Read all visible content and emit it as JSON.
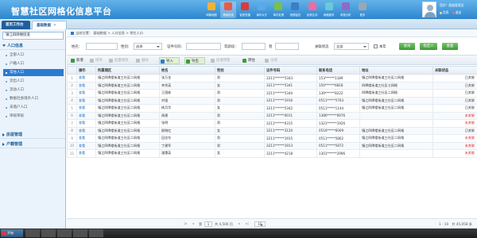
{
  "header": {
    "app_title": "智慧社区网格化信息平台",
    "user_greeting": "您好！超级管理员",
    "links": [
      "信息",
      "退出"
    ],
    "modules": [
      {
        "label": "网格地图",
        "color": "#f3b233",
        "icon": "map-icon"
      },
      {
        "label": "基础信息",
        "color": "#e95a4a",
        "icon": "database-icon",
        "active": true
      },
      {
        "label": "智慧党建",
        "color": "#d83c3c",
        "icon": "party-icon"
      },
      {
        "label": "事件大厅",
        "color": "#5aa9e8",
        "icon": "event-icon"
      },
      {
        "label": "事件处理",
        "color": "#7bc043",
        "icon": "process-icon"
      },
      {
        "label": "视频监控",
        "color": "#3c7fc4",
        "icon": "camera-icon"
      },
      {
        "label": "民情互动",
        "color": "#f06aa0",
        "icon": "chat-icon"
      },
      {
        "label": "网格服务",
        "color": "#6bc8d6",
        "icon": "service-icon"
      },
      {
        "label": "考核分析",
        "color": "#8d6cc8",
        "icon": "chart-icon"
      },
      {
        "label": "更多",
        "color": "#9aa7b3",
        "icon": "more-icon"
      }
    ]
  },
  "tabs": [
    {
      "label": "首页工作台"
    },
    {
      "label": "基础数据",
      "close": "✕"
    }
  ],
  "sidebar": {
    "select_value": "镇江四牌楼街道",
    "sections": [
      {
        "label": "人口信息",
        "expanded": true
      },
      {
        "label": "房屋管理",
        "expanded": false
      },
      {
        "label": "户籍管理",
        "expanded": false
      }
    ],
    "items": [
      {
        "label": "全部人口"
      },
      {
        "label": "户籍人口"
      },
      {
        "label": "常住人口",
        "active": true
      },
      {
        "label": "流出人口"
      },
      {
        "label": "流动人口"
      },
      {
        "label": "数据社会境外人口"
      },
      {
        "label": "未落户人口"
      },
      {
        "label": "审核审核"
      }
    ]
  },
  "breadcrumb": "当前位置： 基础数据 > 人口信息 > 常住人口",
  "search": {
    "name_label": "姓名：",
    "gender_label": "性别：",
    "gender_value": "选择",
    "id_label": "证件号码：",
    "age_label": "年龄段：",
    "age_to": "到",
    "status_label": "关联状态",
    "status_value": "全部",
    "minor_label": "本年",
    "buttons": [
      "查询",
      "指定人",
      "重置"
    ]
  },
  "toolbar": [
    {
      "label": "新增",
      "color": "#3a9a3a",
      "icon": "add-icon",
      "disabled": false
    },
    {
      "label": "修改",
      "color": "#c0c0c0",
      "icon": "edit-icon",
      "disabled": true
    },
    {
      "label": "批量修改",
      "color": "#c0c0c0",
      "icon": "batch-edit-icon",
      "disabled": true
    },
    {
      "label": "删除",
      "color": "#c0c0c0",
      "icon": "delete-icon",
      "disabled": true
    },
    {
      "label": "导入",
      "color": "#2b7bd0",
      "icon": "import-icon",
      "disabled": false,
      "highlight": true
    },
    {
      "label": "导出",
      "color": "#3a9a3a",
      "icon": "export-icon",
      "disabled": false,
      "highlight": true
    },
    {
      "label": "民情预警",
      "color": "#c0c0c0",
      "icon": "warning-icon",
      "disabled": true
    },
    {
      "label": "转住",
      "color": "#3a9a3a",
      "icon": "transfer-icon",
      "disabled": false
    },
    {
      "label": "注销",
      "color": "#c0c0c0",
      "icon": "cancel-icon",
      "disabled": true
    }
  ],
  "table": {
    "columns": [
      "",
      "操作",
      "所属辖区",
      "姓名",
      "性别",
      "证件号码",
      "联系电话",
      "地址",
      "关联状态"
    ],
    "view_label": "查看",
    "rows": [
      {
        "district": "镇江四牌楼街道三社区二网格",
        "name": "张万金",
        "gender": "男",
        "id": "3211******5343",
        "phone": "153******1189",
        "address": "镇江四牌楼街道三社区二网格",
        "status": "已关联"
      },
      {
        "district": "镇江四牌楼街道三社区二网格",
        "name": "李秀英",
        "gender": "女",
        "id": "3211******5341",
        "phone": "150******6818",
        "address": "四牌楼街道三社区七网格",
        "status": "已关联"
      },
      {
        "district": "镇江四牌楼街道三社区二网格",
        "name": "王国栋",
        "gender": "男",
        "id": "3211******5340",
        "phone": "139******8222",
        "address": "四牌楼街道三社区二网格",
        "status": "已关联"
      },
      {
        "district": "镇江四牌楼街道三社区二网格",
        "name": "刘强",
        "gender": "男",
        "id": "3211******1916",
        "phone": "0511*****5763",
        "address": "镇江四牌楼街道三社区二网格",
        "status": "已关联"
      },
      {
        "district": "镇江四牌楼街道三社区二网格",
        "name": "杨月华",
        "gender": "女",
        "id": "3211******5342",
        "phone": "0511*****1144",
        "address": "镇江四牌楼街道三社区二网格",
        "status": "已关联"
      },
      {
        "district": "镇江四牌楼街道三社区二网格",
        "name": "周建",
        "gender": "男",
        "id": "3211******0011",
        "phone": "1380******0976",
        "address": "",
        "status": "未关联"
      },
      {
        "district": "镇江四牌楼街道三社区二网格",
        "name": "张明",
        "gender": "男",
        "id": "3211******6315",
        "phone": "1321******1926",
        "address": "",
        "status": "未关联"
      },
      {
        "district": "镇江四牌楼街道三社区二网格",
        "name": "顾晓红",
        "gender": "女",
        "id": "3211******3120",
        "phone": "0516*****6009",
        "address": "镇江四牌楼街道三社区二网格",
        "status": "已关联"
      },
      {
        "district": "镇江四牌楼街道三社区二网格",
        "name": "田忠东",
        "gender": "男",
        "id": "3211******1915",
        "phone": "0511*****5862",
        "address": "镇江四牌楼街道三社区二网格",
        "status": "未关联"
      },
      {
        "district": "镇江四牌楼街道三社区二网格",
        "name": "丁建军",
        "gender": "男",
        "id": "3211******1913",
        "phone": "0511*****5872",
        "address": "镇江四牌楼街道三社区二网格",
        "status": "未关联"
      },
      {
        "district": "镇江四牌楼街道三社区二网格",
        "name": "潘惠英",
        "gender": "女",
        "id": "3211******4218",
        "phone": "1301******2996",
        "address": "",
        "status": "未关联"
      }
    ]
  },
  "pager": {
    "page_label": "第",
    "page_value": "1",
    "total_label": "共 4,506 页",
    "size_value": "10",
    "info": "1 - 10　共 45,058 条"
  },
  "taskbar": {
    "start_label": "开始",
    "items": [
      "",
      "",
      "",
      "",
      ""
    ]
  }
}
